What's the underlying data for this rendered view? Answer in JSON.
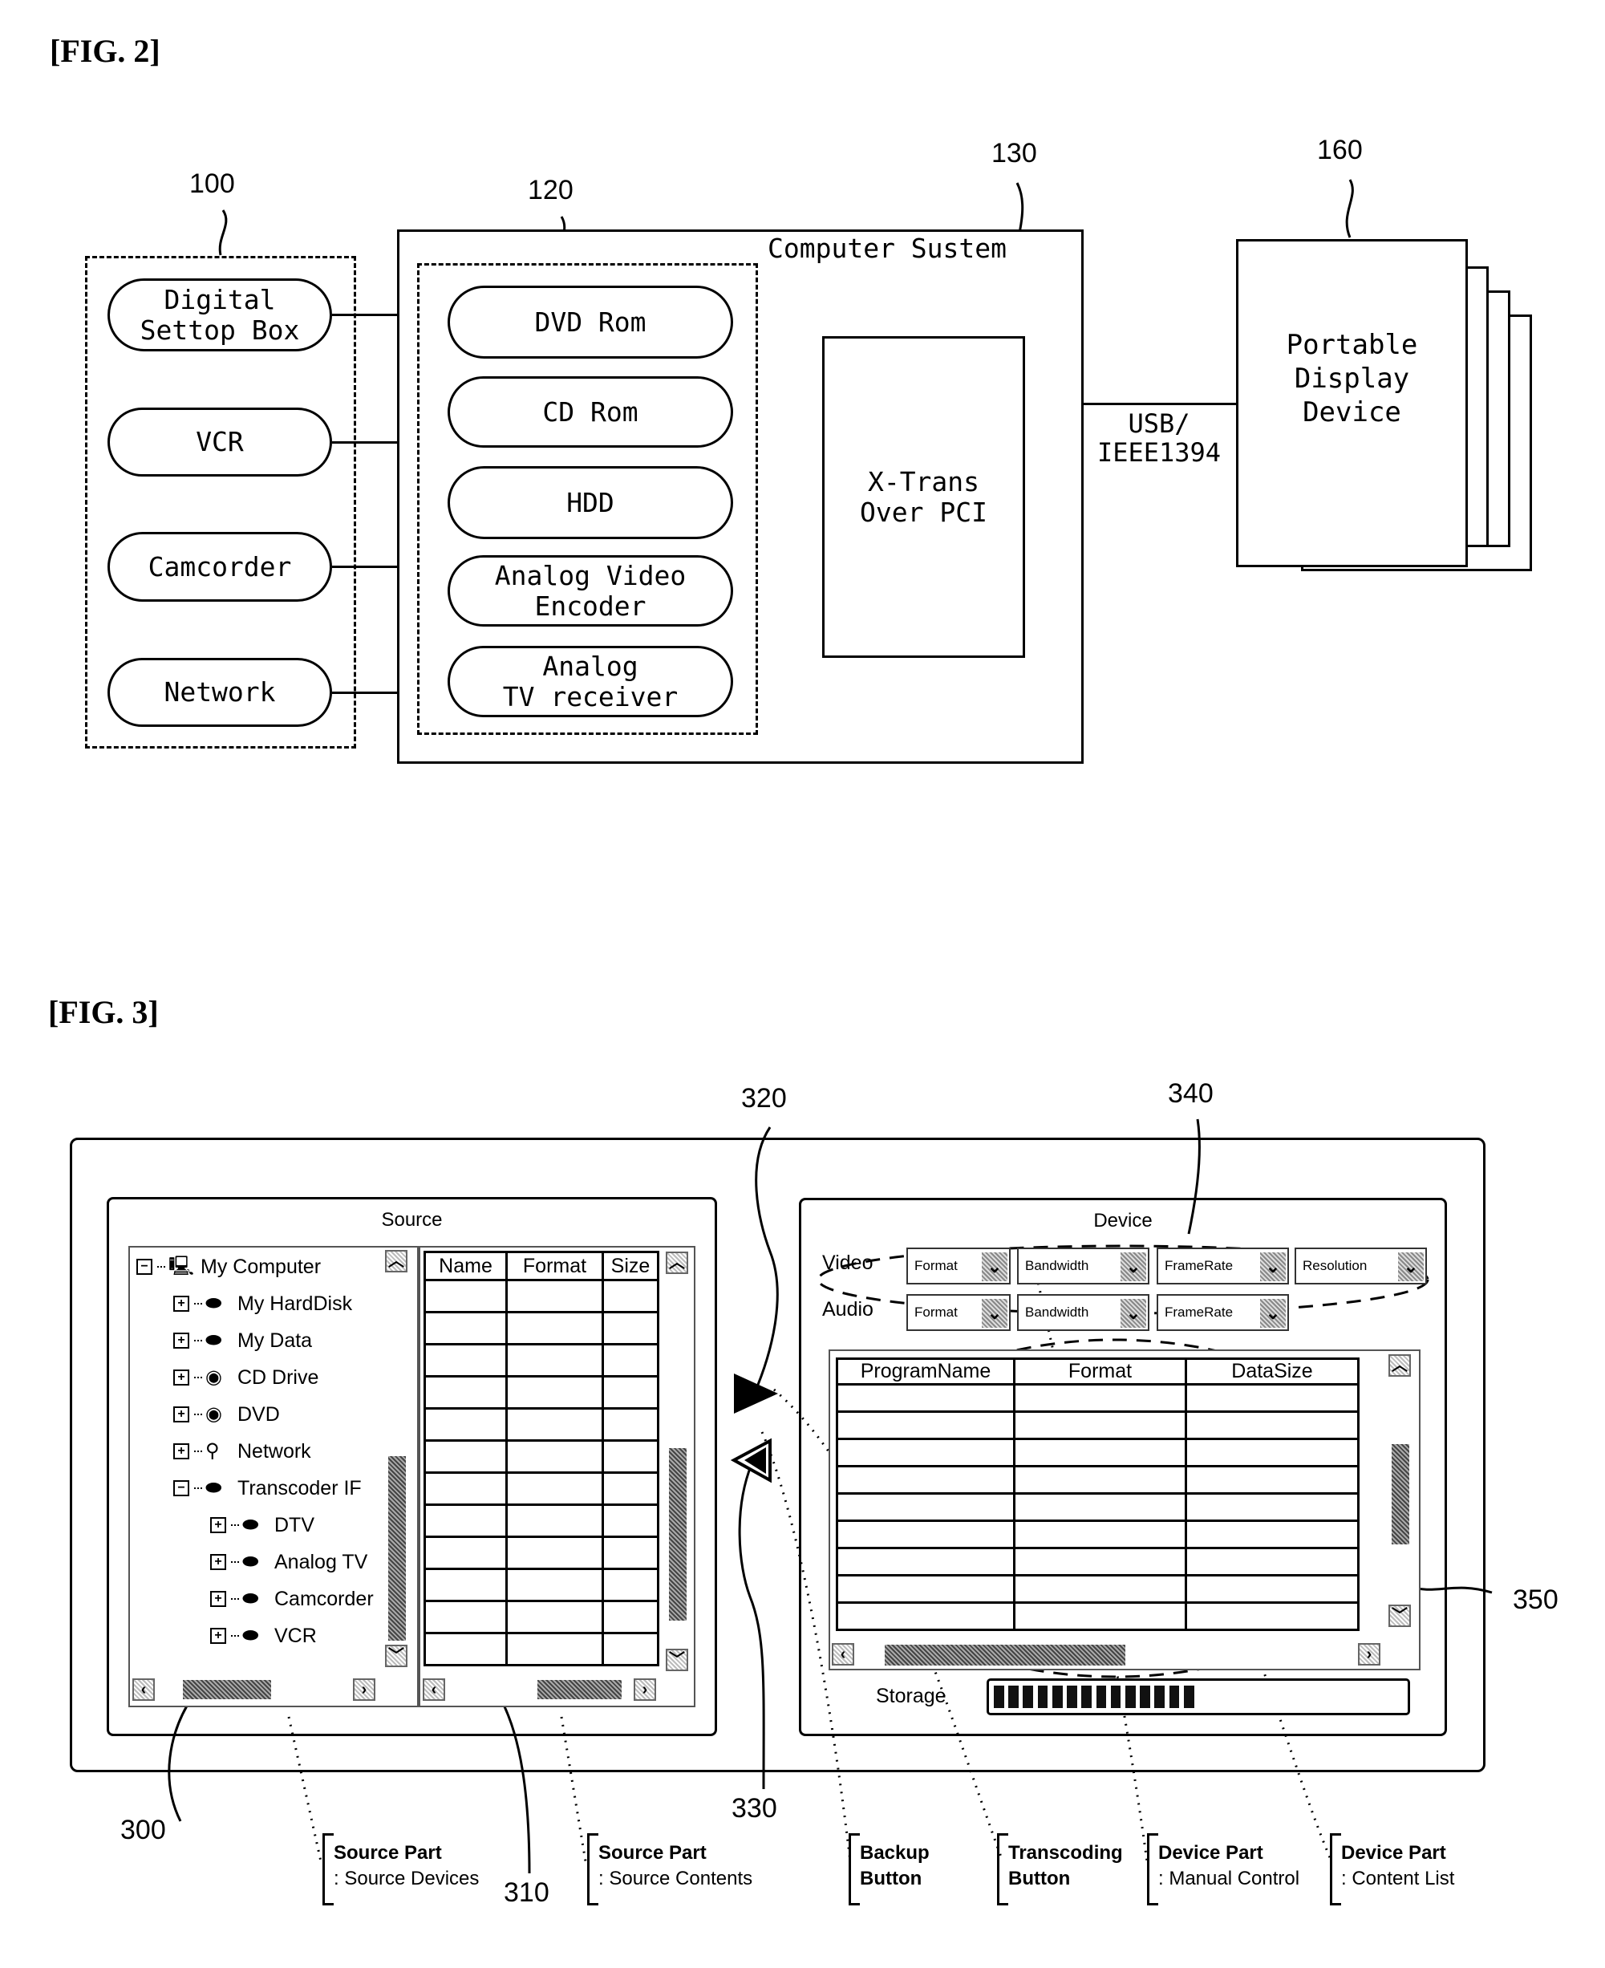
{
  "fig2": {
    "title": "[FIG. 2]",
    "refs": {
      "sources": "100",
      "storage_group": "120",
      "transcoder": "130",
      "portable": "160"
    },
    "source_devices": [
      "Digital\nSettop Box",
      "VCR",
      "Camcorder",
      "Network"
    ],
    "computer_system_label": "Computer Sustem",
    "internal_devices": [
      "DVD Rom",
      "CD Rom",
      "HDD",
      "Analog Video\nEncoder",
      "Analog\nTV receiver"
    ],
    "transcoder_label": "X-Trans\nOver PCI",
    "link_label": "USB/\nIEEE1394",
    "portable_label": "Portable\nDisplay\nDevice"
  },
  "fig3": {
    "title": "[FIG. 3]",
    "refs": {
      "source_devices": "300",
      "source_contents": "310",
      "transcode_btn": "320",
      "backup_btn": "330",
      "manual_control": "340",
      "content_list": "350"
    },
    "source_panel": {
      "title": "Source",
      "tree": [
        {
          "label": "My Computer",
          "expander": "−",
          "level": 0,
          "icon": "computer-icon"
        },
        {
          "label": "My HardDisk",
          "expander": "+",
          "level": 1,
          "icon": "harddisk-icon"
        },
        {
          "label": "My Data",
          "expander": "+",
          "level": 1,
          "icon": "harddisk-icon"
        },
        {
          "label": "CD Drive",
          "expander": "+",
          "level": 1,
          "icon": "disc-icon"
        },
        {
          "label": "DVD",
          "expander": "+",
          "level": 1,
          "icon": "disc-icon"
        },
        {
          "label": "Network",
          "expander": "+",
          "level": 1,
          "icon": "network-icon"
        },
        {
          "label": "Transcoder IF",
          "expander": "−",
          "level": 1,
          "icon": "device-icon"
        },
        {
          "label": "DTV",
          "expander": "+",
          "level": 2,
          "icon": "device-icon"
        },
        {
          "label": "Analog TV",
          "expander": "+",
          "level": 2,
          "icon": "device-icon"
        },
        {
          "label": "Camcorder",
          "expander": "+",
          "level": 2,
          "icon": "device-icon"
        },
        {
          "label": "VCR",
          "expander": "+",
          "level": 2,
          "icon": "device-icon"
        }
      ],
      "table_columns": [
        "Name",
        "Format",
        "Size"
      ],
      "table_rows": 12
    },
    "device_panel": {
      "title": "Device",
      "video_label": "Video",
      "audio_label": "Audio",
      "video_controls": [
        "Format",
        "Bandwidth",
        "FrameRate",
        "Resolution"
      ],
      "audio_controls": [
        "Format",
        "Bandwidth",
        "FrameRate"
      ],
      "table_columns": [
        "ProgramName",
        "Format",
        "DataSize"
      ],
      "table_rows": 9,
      "storage_label": "Storage",
      "storage_fill_segments": 14,
      "storage_fill_fraction": 0.5
    },
    "callouts": [
      {
        "title": "Source Part",
        "sub": ": Source Devices"
      },
      {
        "title": "Source Part",
        "sub": ": Source Contents"
      },
      {
        "title": "Backup",
        "sub": "Button"
      },
      {
        "title": "Transcoding",
        "sub": "Button"
      },
      {
        "title": "Device Part",
        "sub": ": Manual Control"
      },
      {
        "title": "Device Part",
        "sub": ": Content List"
      }
    ]
  }
}
